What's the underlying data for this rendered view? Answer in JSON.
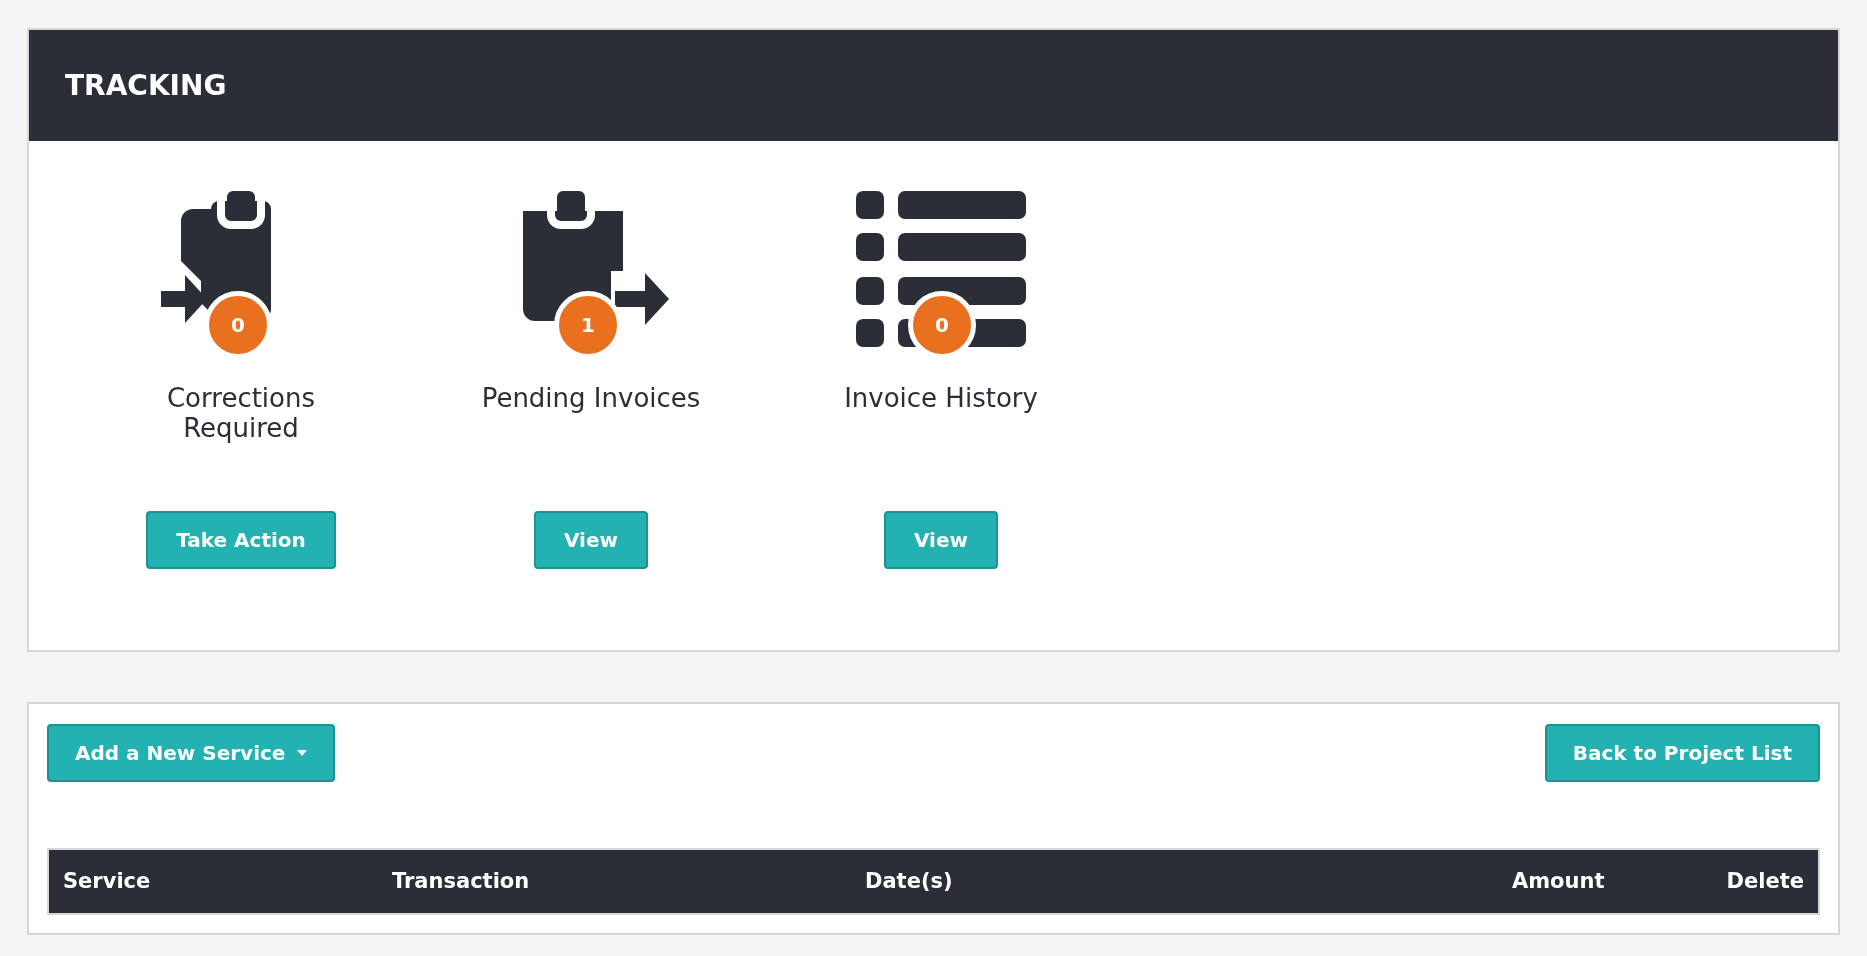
{
  "tracking": {
    "title": "TRACKING",
    "tiles": [
      {
        "kind": "corrections",
        "count": "0",
        "label": "Corrections Required",
        "button": "Take Action"
      },
      {
        "kind": "pending",
        "count": "1",
        "label": "Pending Invoices",
        "button": "View"
      },
      {
        "kind": "history",
        "count": "0",
        "label": "Invoice History",
        "button": "View"
      }
    ]
  },
  "services": {
    "add_button": "Add a New Service",
    "back_button": "Back to Project List",
    "table": {
      "columns": [
        "Service",
        "Transaction",
        "Date(s)",
        "Amount",
        "Delete"
      ]
    }
  }
}
